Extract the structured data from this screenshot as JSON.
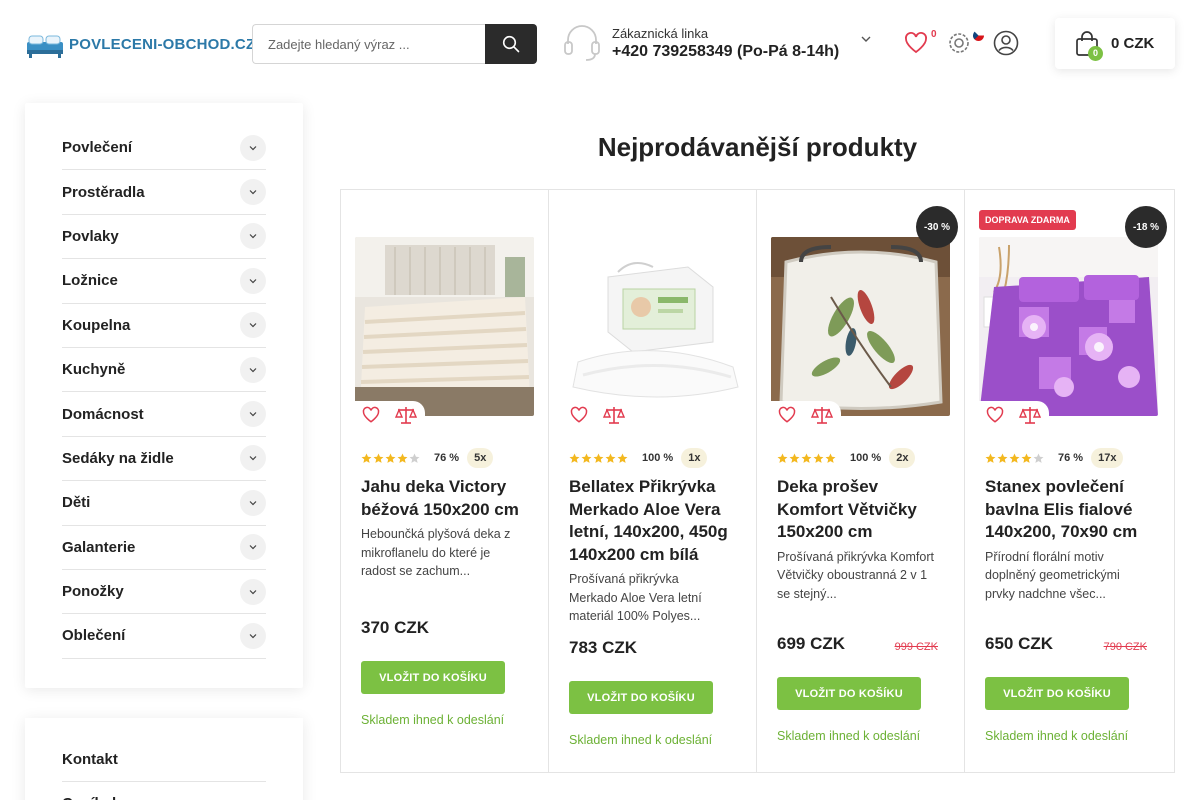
{
  "header": {
    "logo_text": "POVLECENI-OBCHOD.CZ",
    "search_placeholder": "Zadejte hledaný výraz ...",
    "contact_label": "Zákaznická linka",
    "contact_phone": "+420 739258349 (Po-Pá 8-14h)",
    "wishlist_count": "0",
    "cart_count": "0",
    "cart_total": "0 CZK",
    "icons": [
      "search-icon",
      "headset-icon",
      "chevron-down-icon",
      "heart-icon",
      "settings-icon",
      "czech-flag-icon",
      "user-icon",
      "shopping-bag-icon"
    ]
  },
  "sidebar": {
    "categories": [
      {
        "label": "Povlečení"
      },
      {
        "label": "Prostěradla"
      },
      {
        "label": "Povlaky"
      },
      {
        "label": "Ložnice"
      },
      {
        "label": "Koupelna"
      },
      {
        "label": "Kuchyně"
      },
      {
        "label": "Domácnost"
      },
      {
        "label": "Sedáky na židle"
      },
      {
        "label": "Děti"
      },
      {
        "label": "Galanterie"
      },
      {
        "label": "Ponožky"
      },
      {
        "label": "Oblečení"
      }
    ],
    "secondary": [
      {
        "label": "Kontakt"
      },
      {
        "label": "Ceník dopravy"
      }
    ]
  },
  "main": {
    "section_title": "Nejprodávanější produkty",
    "products": [
      {
        "name": "Jahu deka Victory béžová 150x200 cm",
        "description": "Hebounčká plyšová deka z mikroflanelu do které je radost se zachum...",
        "rating_stars": 4,
        "rating_percent": "76 %",
        "rating_count": "5x",
        "price": "370 CZK",
        "old_price": "",
        "discount": "",
        "badge": "",
        "button": "VLOŽIT DO KOŠÍKU",
        "stock": "Skladem ihned k odeslání"
      },
      {
        "name": "Bellatex Přikrývka Merkado Aloe Vera letní, 140x200, 450g 140x200 cm bílá",
        "description": "Prošívaná přikrývka Merkado Aloe Vera letní materiál 100% Polyes...",
        "rating_stars": 5,
        "rating_percent": "100 %",
        "rating_count": "1x",
        "price": "783 CZK",
        "old_price": "",
        "discount": "",
        "badge": "",
        "button": "VLOŽIT DO KOŠÍKU",
        "stock": "Skladem ihned k odeslání"
      },
      {
        "name": "Deka prošev Komfort Větvičky 150x200 cm",
        "description": "Prošívaná přikrývka Komfort Větvičky oboustranná 2 v 1 se stejný...",
        "rating_stars": 5,
        "rating_percent": "100 %",
        "rating_count": "2x",
        "price": "699 CZK",
        "old_price": "999 CZK",
        "discount": "-30 %",
        "badge": "",
        "button": "VLOŽIT DO KOŠÍKU",
        "stock": "Skladem ihned k odeslání"
      },
      {
        "name": "Stanex povlečení bavlna Elis fialové 140x200, 70x90 cm",
        "description": "Přírodní florální motiv doplněný geometrickými prvky nadchne všec...",
        "rating_stars": 4,
        "rating_percent": "76 %",
        "rating_count": "17x",
        "price": "650 CZK",
        "old_price": "790 CZK",
        "discount": "-18 %",
        "badge": "DOPRAVA ZDARMA",
        "button": "VLOŽIT DO KOŠÍKU",
        "stock": "Skladem ihned k odeslání"
      }
    ]
  },
  "colors": {
    "accent_green": "#7cc143",
    "stock_green": "#6cb135",
    "sale_red": "#e23b4f",
    "dark": "#2b2b2b",
    "star": "#f3b81f"
  }
}
